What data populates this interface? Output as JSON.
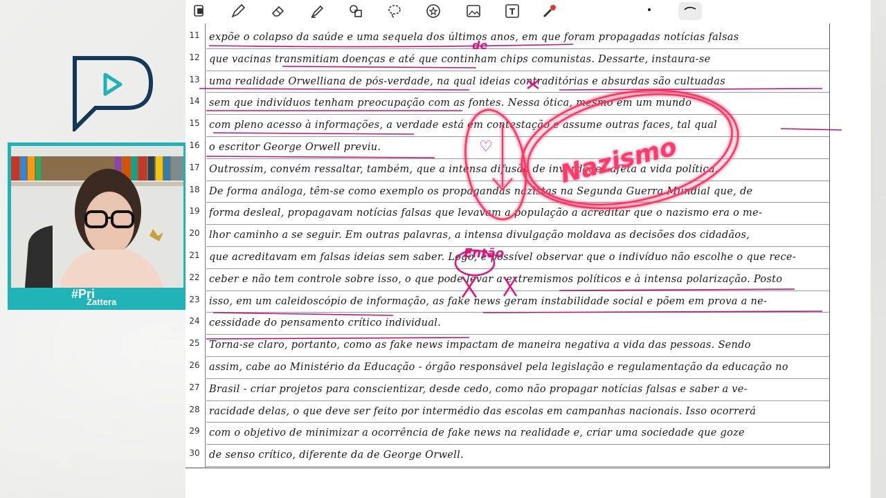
{
  "toolbar": {
    "tools": [
      {
        "icon": "layers-icon"
      },
      {
        "icon": "pen-icon"
      },
      {
        "icon": "eraser-icon"
      },
      {
        "icon": "highlighter-icon"
      },
      {
        "icon": "shapes-icon"
      },
      {
        "icon": "lasso-icon"
      },
      {
        "icon": "sticker-icon"
      },
      {
        "icon": "image-icon"
      },
      {
        "icon": "text-tool-icon"
      },
      {
        "icon": "laser-pointer-icon"
      },
      {
        "icon": "dot-icon"
      },
      {
        "icon": "stroke-icon"
      }
    ],
    "colors": {
      "accent": "#e0127a",
      "toolbar_bg": "#ffffff"
    }
  },
  "brand": {
    "hashtag": "#Pri",
    "name": "Zattera",
    "accent": "#1fb3b7",
    "logo_dark": "#13385a"
  },
  "document": {
    "lines": [
      {
        "n": "11",
        "text": "expõe o colapso da saúde e uma sequela dos últimos anos, em que foram propagadas notícias falsas"
      },
      {
        "n": "12",
        "text": "que vacinas transmitiam doenças e até que continham chips comunistas. Dessarte, instaura-se"
      },
      {
        "n": "13",
        "text": "uma realidade Orwelliana de pós-verdade, na qual ideias contraditórias e absurdas são cultuadas"
      },
      {
        "n": "14",
        "text": "sem que indivíduos tenham preocupação com as fontes. Nessa ótica, mesmo em um mundo"
      },
      {
        "n": "15",
        "text": "com pleno acesso à informações, a verdade está em contestação e assume outras faces, tal qual"
      },
      {
        "n": "16",
        "text": "o escritor George Orwell previu."
      },
      {
        "n": "17",
        "text": "Outrossim, convém ressaltar, também, que a intensa difusão de inverdades afeta a vida política."
      },
      {
        "n": "18",
        "text": "De forma análoga, têm-se como exemplo os propagandas nazistas na Segunda Guerra Mundial que, de"
      },
      {
        "n": "19",
        "text": "forma desleal, propagavam notícias falsas que levavam a população a acreditar que o nazismo era o me-"
      },
      {
        "n": "20",
        "text": "lhor caminho a se seguir. Em outras palavras, a intensa divulgação moldava as decisões dos cidadãos,"
      },
      {
        "n": "21",
        "text": "que acreditavam em falsas ideias sem saber. Logo, é possível observar que o indivíduo não escolhe o que rece-"
      },
      {
        "n": "22",
        "text": "ceber e não tem controle sobre isso, o que pode levar a extremismos políticos e à intensa polarização. Posto"
      },
      {
        "n": "23",
        "text": "isso, em um caleidoscópio de informação, as fake news geram instabilidade social e põem em prova a ne-"
      },
      {
        "n": "24",
        "text": "cessidade do pensamento crítico individual."
      },
      {
        "n": "25",
        "text": "Torna-se claro, portanto, como as fake news impactam de maneira negativa a vida das pessoas. Sendo"
      },
      {
        "n": "26",
        "text": "assim, cabe ao Ministério da Educação - órgão responsável pela legislação e regulamentação da educação no"
      },
      {
        "n": "27",
        "text": "Brasil - criar projetos para conscientizar, desde cedo, como não propagar notícias falsas e saber a ve-"
      },
      {
        "n": "28",
        "text": "racidade delas, o que deve ser feito por intermédio das escolas em campanhas nacionais. Isso ocorrerá"
      },
      {
        "n": "29",
        "text": "com o objetivo de minimizar a ocorrência de fake news na realidade e, criar uma sociedade que goze"
      },
      {
        "n": "30",
        "text": "de senso crítico, diferente da de George Orwell."
      }
    ]
  },
  "annotations": {
    "nazismo": "Nazismo",
    "entao": "Então",
    "de": "de",
    "heart": "♡",
    "colors": {
      "ink": "#e0127a",
      "glow": "#ff3b6b"
    }
  }
}
